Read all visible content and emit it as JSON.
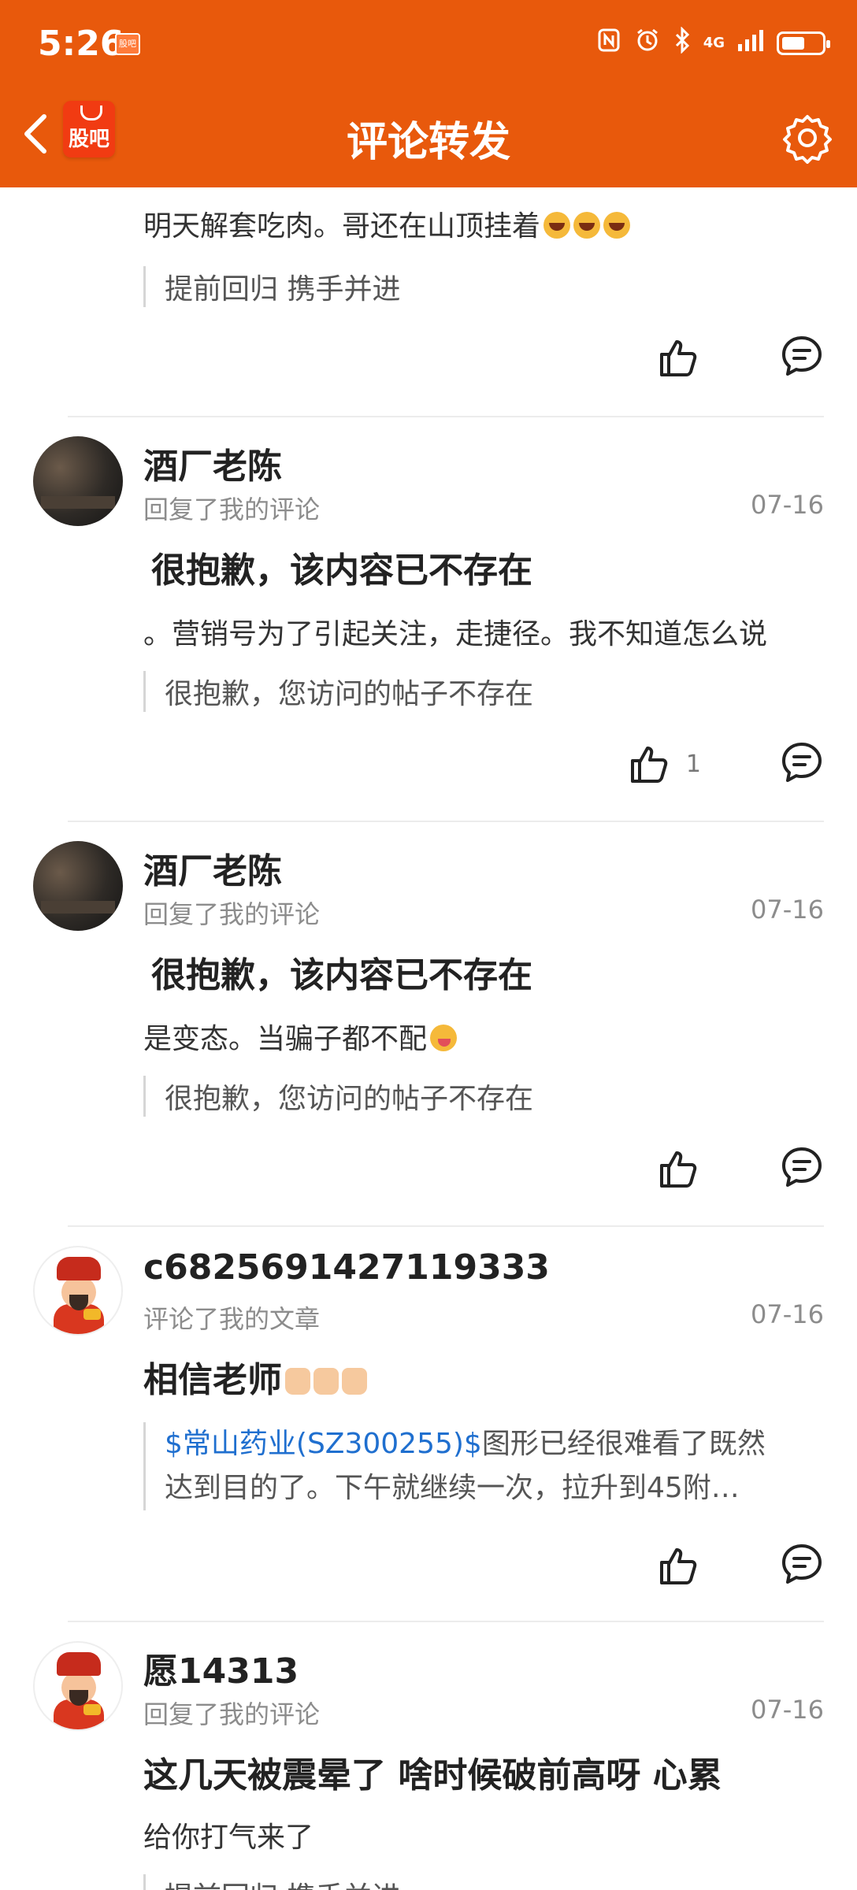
{
  "status_bar": {
    "time": "5:26",
    "mini_logo": "股吧",
    "network": "4G"
  },
  "header": {
    "title": "评论转发",
    "logo_text": "股吧"
  },
  "icons": {
    "back": "chevron-left-icon",
    "settings": "gear-icon",
    "like": "thumbs-up-icon",
    "reply": "comment-icon"
  },
  "colors": {
    "brand": "#e8590c",
    "link": "#1f6fcf",
    "muted": "#8c8c8c"
  },
  "items": [
    {
      "body": "明天解套吃肉。哥还在山顶挂着",
      "quote": "提前回归 携手并进"
    },
    {
      "username": "酒厂老陈",
      "action": "回复了我的评论",
      "date": "07-16",
      "title": "很抱歉，该内容已不存在",
      "body": "。营销号为了引起关注，走捷径。我不知道怎么说",
      "quote": "很抱歉，您访问的帖子不存在",
      "likes": "1"
    },
    {
      "username": "酒厂老陈",
      "action": "回复了我的评论",
      "date": "07-16",
      "title": "很抱歉，该内容已不存在",
      "body": "是变态。当骗子都不配",
      "quote": "很抱歉，您访问的帖子不存在"
    },
    {
      "username": "c6825691427119333",
      "action": "评论了我的文章",
      "date": "07-16",
      "title": "相信老师",
      "quote_stock": "$常山药业(SZ300255)$",
      "quote_line1": "图形已经很难看了既然",
      "quote_line2": "达到目的了。下午就继续一次，拉升到45附…"
    },
    {
      "username": "愿14313",
      "action": "回复了我的评论",
      "date": "07-16",
      "title": "这几天被震晕了 啥时候破前高呀 心累",
      "body": "给你打气来了",
      "quote": "提前回归 携手并进"
    }
  ]
}
